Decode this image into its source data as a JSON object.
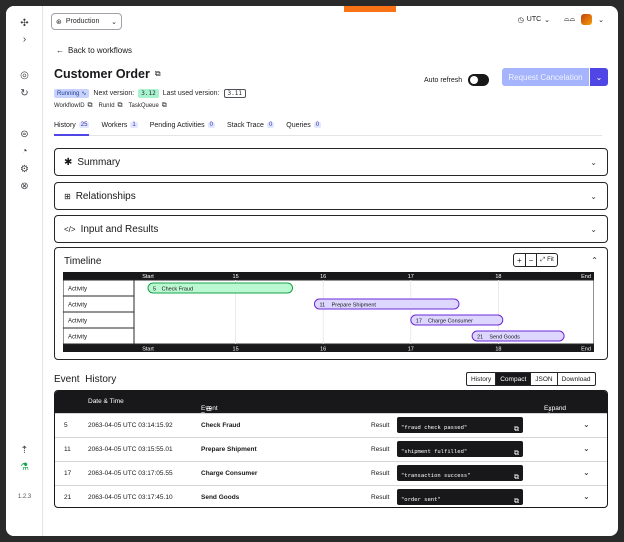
{
  "app": {
    "version": "1.2.3"
  },
  "header": {
    "namespace": "Production",
    "timezone": "UTC"
  },
  "workflow": {
    "back_label": "Back to workflows",
    "title": "Customer Order",
    "status": "Running",
    "next_version_label": "Next version:",
    "next_version": "3.12",
    "last_version_label": "Last used version:",
    "last_version": "3.11",
    "ids": [
      "WorkflowID",
      "RunId",
      "TaskQueue"
    ],
    "auto_refresh_label": "Auto refresh",
    "request_cancel_label": "Request Cancelation"
  },
  "tabs": [
    {
      "label": "History",
      "count": "25"
    },
    {
      "label": "Workers",
      "count": "1"
    },
    {
      "label": "Pending Activities",
      "count": "0"
    },
    {
      "label": "Stack Trace",
      "count": "0"
    },
    {
      "label": "Queries",
      "count": "0"
    }
  ],
  "sections": [
    "Summary",
    "Relationships",
    "Input and Results"
  ],
  "timeline": {
    "title": "Timeline",
    "fit_label": "Fit",
    "ticks": [
      "Start",
      "15",
      "16",
      "17",
      "18",
      "End"
    ],
    "rows": [
      "Activity",
      "Activity",
      "Activity",
      "Activity"
    ],
    "events": [
      {
        "id": "5",
        "name": "Check Fraud",
        "start": 0.0,
        "end": 0.33,
        "color": "#bbf7d0",
        "border": "#16a34a"
      },
      {
        "id": "11",
        "name": "Prepare Shipment",
        "start": 0.38,
        "end": 0.71,
        "color": "#ddd6fe",
        "border": "#6d28d9"
      },
      {
        "id": "17",
        "name": "Charge Consumer",
        "start": 0.6,
        "end": 0.81,
        "color": "#ddd6fe",
        "border": "#6d28d9"
      },
      {
        "id": "21",
        "name": "Send Goods",
        "start": 0.74,
        "end": 0.95,
        "color": "#ddd6fe",
        "border": "#6d28d9"
      }
    ]
  },
  "event_history": {
    "title": "Event  History",
    "views": [
      "History",
      "Compact",
      "JSON",
      "Download"
    ],
    "active_view": "Compact",
    "col_date": "Date & Time",
    "col_type": "Event Type",
    "expand_all": "Expand all",
    "result_label": "Result",
    "rows": [
      {
        "id": "5",
        "date": "2063-04-05 UTC 03:14:15.92",
        "type": "Check Fraud",
        "result": "\"fraud check passed\""
      },
      {
        "id": "11",
        "date": "2063-04-05 UTC 03:15:55.01",
        "type": "Prepare Shipment",
        "result": "\"shipment fulfilled\""
      },
      {
        "id": "17",
        "date": "2063-04-05 UTC 03:17:05.55",
        "type": "Charge Consumer",
        "result": "\"transaction success\""
      },
      {
        "id": "21",
        "date": "2063-04-05 UTC 03:17:45.10",
        "type": "Send Goods",
        "result": "\"order sent\""
      }
    ]
  }
}
